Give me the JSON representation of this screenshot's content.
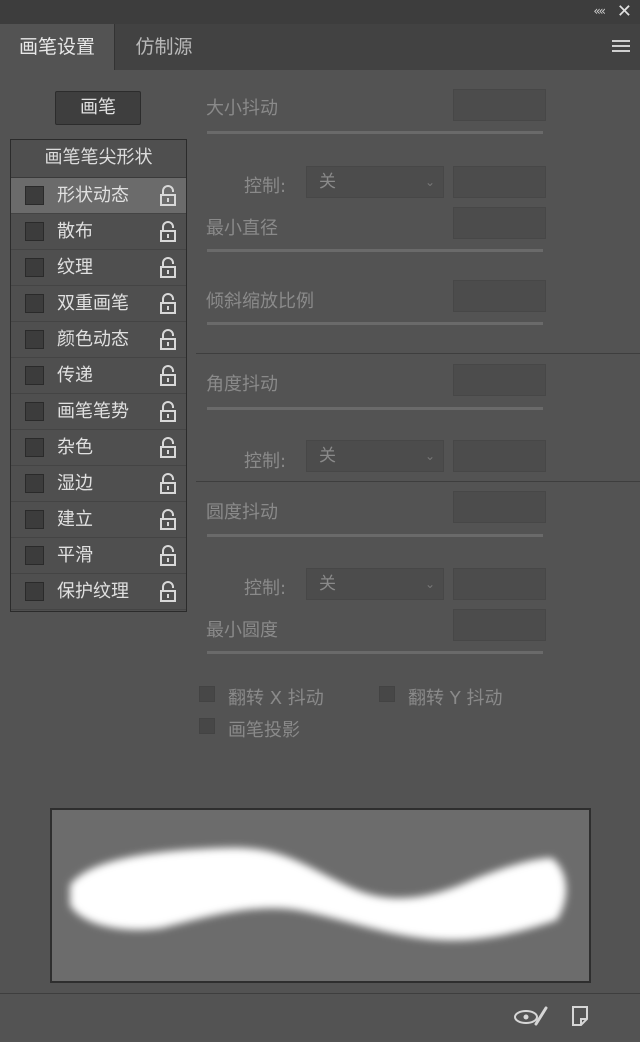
{
  "window": {
    "collapse_glyph": "««",
    "close_glyph": "✕"
  },
  "tabs": [
    {
      "label": "画笔设置",
      "active": true
    },
    {
      "label": "仿制源",
      "active": false
    }
  ],
  "sidebar": {
    "brushes_button": "画笔",
    "header": "画笔笔尖形状",
    "items": [
      {
        "label": "形状动态",
        "checked": false,
        "selected": true
      },
      {
        "label": "散布",
        "checked": false,
        "selected": false
      },
      {
        "label": "纹理",
        "checked": false,
        "selected": false
      },
      {
        "label": "双重画笔",
        "checked": false,
        "selected": false
      },
      {
        "label": "颜色动态",
        "checked": false,
        "selected": false
      },
      {
        "label": "传递",
        "checked": false,
        "selected": false
      },
      {
        "label": "画笔笔势",
        "checked": false,
        "selected": false
      },
      {
        "label": "杂色",
        "checked": false,
        "selected": false
      },
      {
        "label": "湿边",
        "checked": false,
        "selected": false
      },
      {
        "label": "建立",
        "checked": false,
        "selected": false
      },
      {
        "label": "平滑",
        "checked": false,
        "selected": false
      },
      {
        "label": "保护纹理",
        "checked": false,
        "selected": false
      }
    ]
  },
  "settings": {
    "size_jitter": {
      "label": "大小抖动",
      "value": ""
    },
    "size_control": {
      "label": "控制:",
      "value": "关",
      "field": ""
    },
    "min_diameter": {
      "label": "最小直径",
      "value": ""
    },
    "tilt_scale": {
      "label": "倾斜缩放比例",
      "value": ""
    },
    "angle_jitter": {
      "label": "角度抖动",
      "value": ""
    },
    "angle_control": {
      "label": "控制:",
      "value": "关",
      "field": ""
    },
    "roundness_jitter": {
      "label": "圆度抖动",
      "value": ""
    },
    "roundness_control": {
      "label": "控制:",
      "value": "关",
      "field": ""
    },
    "min_roundness": {
      "label": "最小圆度",
      "value": ""
    },
    "flip_x": {
      "label": "翻转 X 抖动",
      "checked": false
    },
    "flip_y": {
      "label": "翻转 Y 抖动",
      "checked": false
    },
    "brush_projection": {
      "label": "画笔投影",
      "checked": false
    }
  },
  "bottom_bar": {
    "icons": [
      "eye-brush-icon",
      "new-preset-icon"
    ]
  },
  "colors": {
    "panel_bg": "#535353",
    "tab_bar": "#424242",
    "disabled_text": "#8a8a8a",
    "preview_bg": "#6c6c6c"
  }
}
